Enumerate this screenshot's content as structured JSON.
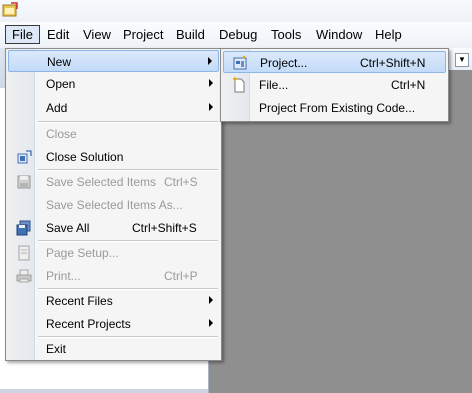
{
  "menubar": {
    "items": [
      "File",
      "Edit",
      "View",
      "Project",
      "Build",
      "Debug",
      "Tools",
      "Window",
      "Help"
    ]
  },
  "file_menu": {
    "new": "New",
    "open": "Open",
    "add": "Add",
    "close": "Close",
    "close_solution": "Close Solution",
    "save_selected": "Save Selected Items",
    "save_selected_shortcut": "Ctrl+S",
    "save_selected_as": "Save Selected Items As...",
    "save_all": "Save All",
    "save_all_shortcut": "Ctrl+Shift+S",
    "page_setup": "Page Setup...",
    "print": "Print...",
    "print_shortcut": "Ctrl+P",
    "recent_files": "Recent Files",
    "recent_projects": "Recent Projects",
    "exit": "Exit"
  },
  "new_submenu": {
    "project": "Project...",
    "project_shortcut": "Ctrl+Shift+N",
    "file": "File...",
    "file_shortcut": "Ctrl+N",
    "from_existing": "Project From Existing Code..."
  }
}
